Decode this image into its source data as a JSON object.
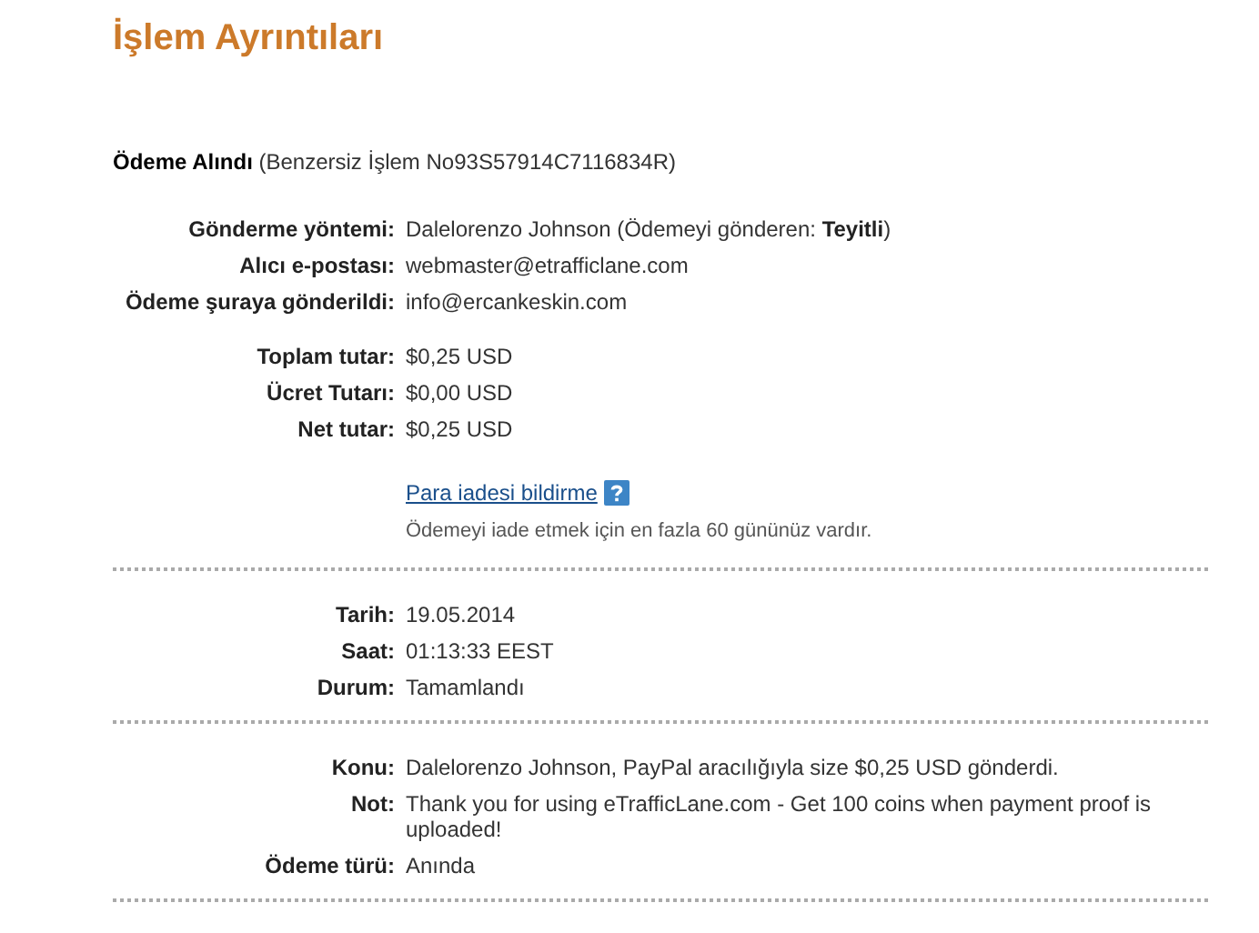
{
  "title": "İşlem Ayrıntıları",
  "header": "**Ödeme Alındı** (Benzersiz İşlem No93S57914C7116834R)",
  "sections": [
    {
      "groups": [
        {
          "rows": [
            {
              "label": "Gönderme yöntemi:",
              "value": "Dalelorenzo Johnson (Ödemeyi gönderen: **Teyitli**)"
            },
            {
              "label": "Alıcı e-postası:",
              "value": "webmaster@etrafficlane.com"
            },
            {
              "label": "Ödeme şuraya gönderildi:",
              "value": "info@ercankeskin.com"
            }
          ]
        },
        {
          "rows": [
            {
              "label": "Toplam tutar:",
              "value": "$0,25 USD"
            },
            {
              "label": "Ücret Tutarı:",
              "value": "$0,00 USD"
            },
            {
              "label": "Net tutar:",
              "value": "$0,25 USD"
            }
          ]
        }
      ],
      "link": "Para iadesi bildirme",
      "note": "Ödemeyi iade etmek için en fazla 60 gününüz vardır."
    },
    {
      "groups": [
        {
          "rows": [
            {
              "label": "Tarih:",
              "value": "19.05.2014"
            },
            {
              "label": "Saat:",
              "value": "01:13:33 EEST"
            },
            {
              "label": "Durum:",
              "value": "Tamamlandı"
            }
          ]
        }
      ]
    },
    {
      "groups": [
        {
          "rows": [
            {
              "label": "Konu:",
              "value": "Dalelorenzo Johnson, PayPal aracılığıyla size $0,25 USD gönderdi."
            },
            {
              "label": "Not:",
              "value": "Thank you for using eTrafficLane.com - Get 100 coins when payment proof is uploaded!"
            },
            {
              "label": "Ödeme türü:",
              "value": "Anında"
            }
          ]
        }
      ]
    }
  ]
}
